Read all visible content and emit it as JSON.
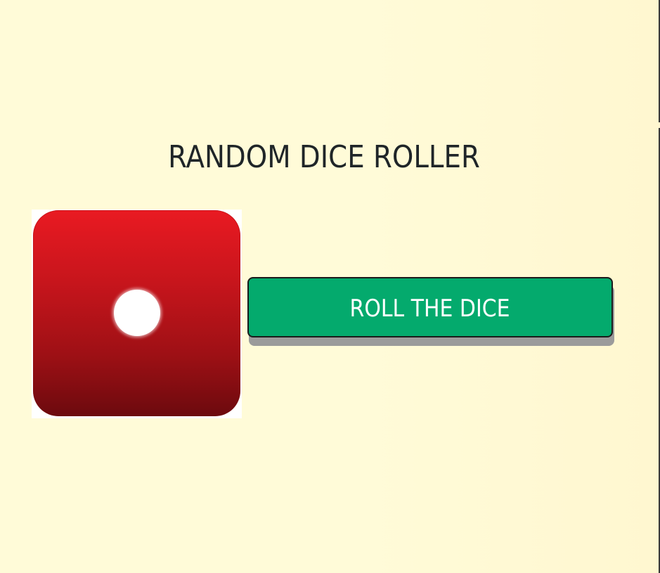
{
  "page": {
    "title": "RANDOM DICE ROLLER"
  },
  "dice": {
    "value": 1,
    "icon": "die-face-1-icon",
    "color": "#d4151c",
    "pip_color": "#ffffff"
  },
  "controls": {
    "roll_label": "ROLL THE DICE",
    "roll_color": "#04aa6d"
  },
  "colors": {
    "background": "#fffbd8",
    "text": "#1f2528"
  }
}
